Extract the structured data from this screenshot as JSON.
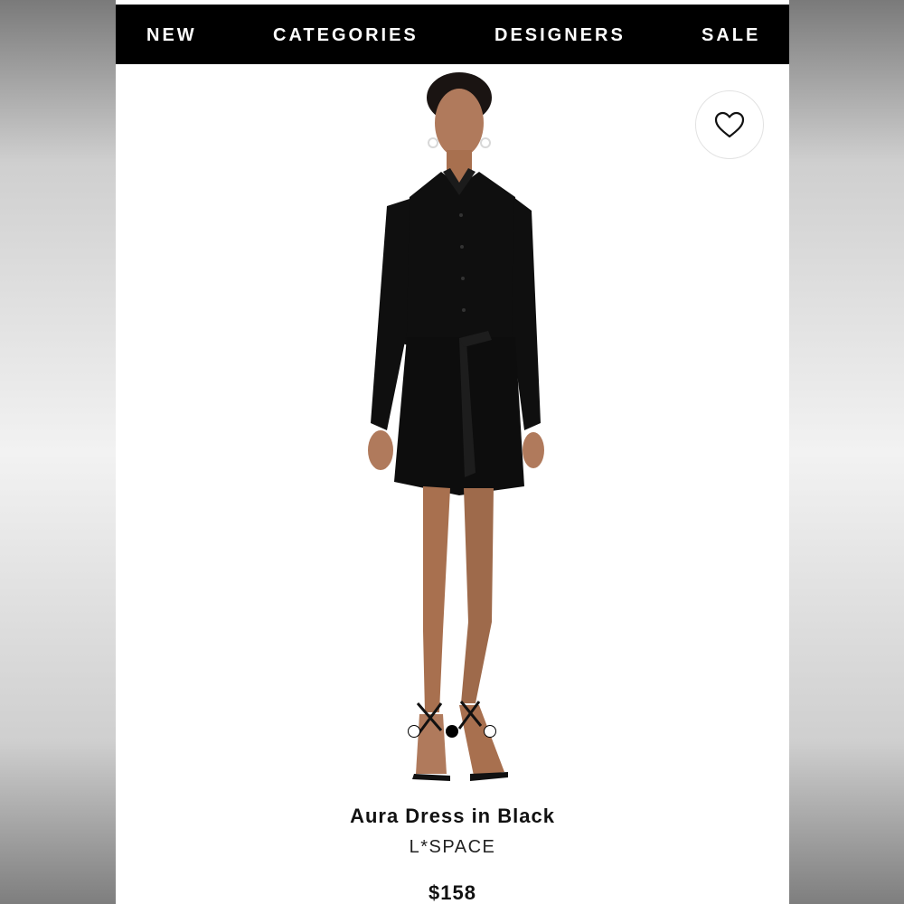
{
  "nav": {
    "items": [
      "NEW",
      "CATEGORIES",
      "DESIGNERS",
      "SALE"
    ]
  },
  "favorite": {
    "icon": "heart-icon"
  },
  "gallery": {
    "image": "model-wearing-black-shirt-dress",
    "dots": 3,
    "active_dot": 2
  },
  "product": {
    "title": "Aura Dress in Black",
    "brand": "L*SPACE",
    "price": "$158"
  },
  "colors": {
    "nav_bg": "#000000",
    "nav_text": "#ffffff",
    "text": "#111111"
  }
}
